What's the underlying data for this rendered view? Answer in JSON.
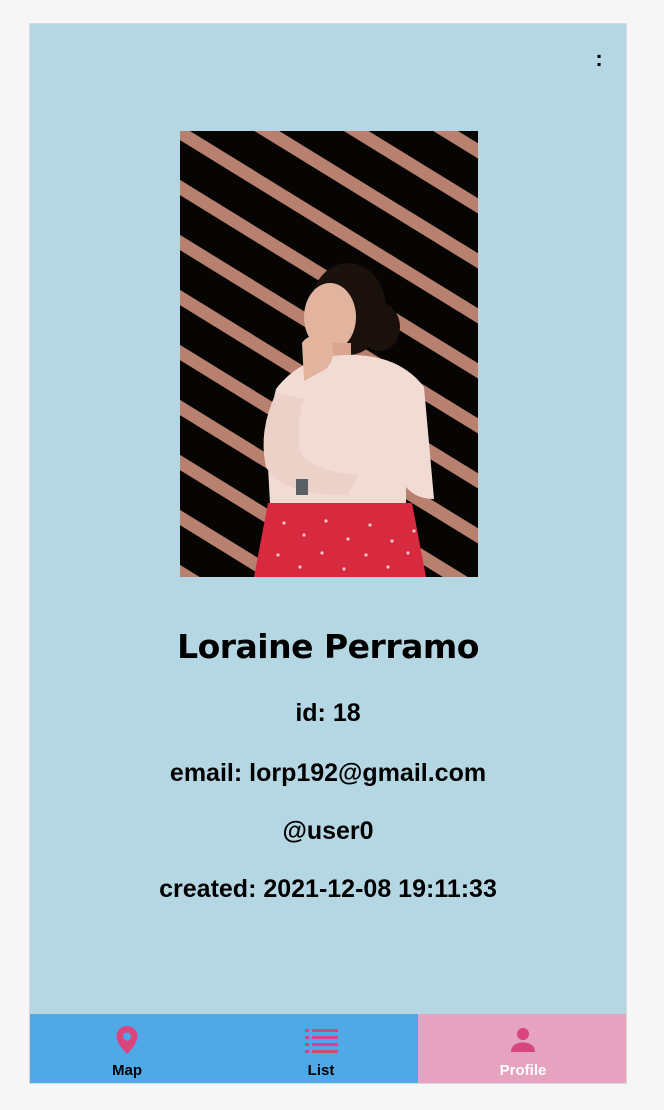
{
  "menu": {
    "icon": "more-menu-icon",
    "label": ":"
  },
  "profile": {
    "photo": "profile-photo",
    "name": "Loraine Perramo",
    "id_text": "id: 18",
    "email_text": "email: lorp192@gmail.com",
    "username_text": "@user0",
    "created_text": "created: 2021-12-08 19:11:33"
  },
  "tabs": [
    {
      "label": "Map",
      "icon": "map-pin-icon",
      "active": false
    },
    {
      "label": "List",
      "icon": "list-icon",
      "active": false
    },
    {
      "label": "Profile",
      "icon": "person-icon",
      "active": true
    }
  ],
  "colors": {
    "background": "#b5d7e4",
    "tab_bar": "#4ea9e6",
    "tab_active": "#e6a3c0",
    "icon_accent": "#d9467e"
  }
}
